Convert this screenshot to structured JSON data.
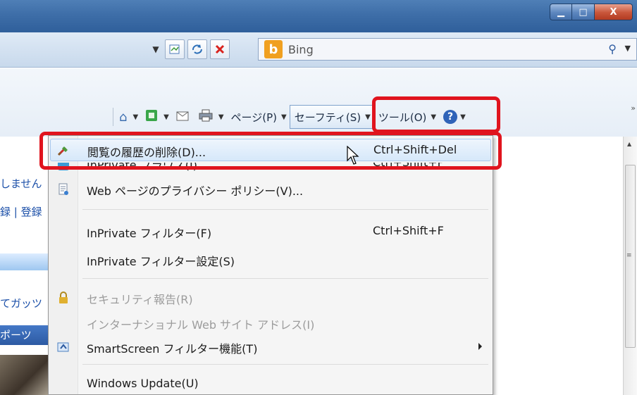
{
  "window": {
    "minimize_glyph": "▁",
    "maximize_glyph": "□",
    "close_glyph": "X"
  },
  "address": {
    "search_provider": "Bing",
    "search_provider_logo": "b"
  },
  "commandbar": {
    "page_label": "ページ(P)",
    "safety_label": "セーフティ(S)",
    "tools_label": "ツール(O)",
    "help_glyph": "?",
    "more_glyph": "»"
  },
  "page_fragments": {
    "line1": "しません",
    "line2": "録 | 登録",
    "line3": "てガッツ",
    "line4": "ポーツ"
  },
  "menu": {
    "items": [
      {
        "label": "閲覧の履歴の削除(D)...",
        "shortcut": "Ctrl+Shift+Del"
      },
      {
        "label": "InPrivate ブラウズ(I)",
        "shortcut": "Ctrl+Shift+P"
      },
      {
        "label": "Web ページのプライバシー ポリシー(V)..."
      },
      {
        "label": "InPrivate フィルター(F)",
        "shortcut": "Ctrl+Shift+F"
      },
      {
        "label": "InPrivate フィルター設定(S)"
      },
      {
        "label": "セキュリティ報告(R)"
      },
      {
        "label": "インターナショナル Web サイト アドレス(I)"
      },
      {
        "label": "SmartScreen フィルター機能(T)"
      },
      {
        "label": "Windows Update(U)"
      }
    ]
  },
  "colors": {
    "highlight_red": "#e0141e",
    "menu_hover": "#d6e8fa"
  }
}
